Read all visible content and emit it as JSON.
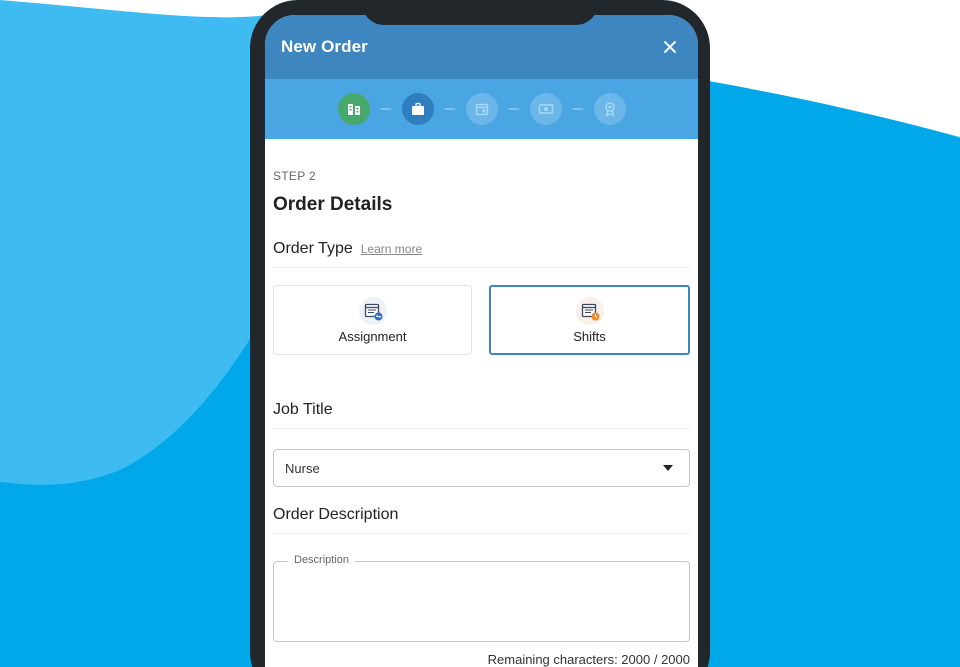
{
  "header": {
    "title": "New Order"
  },
  "stepper": {
    "steps": [
      {
        "icon": "building-icon",
        "state": "done"
      },
      {
        "icon": "briefcase-icon",
        "state": "active"
      },
      {
        "icon": "calendar-icon",
        "state": "pending"
      },
      {
        "icon": "money-icon",
        "state": "pending"
      },
      {
        "icon": "award-icon",
        "state": "pending"
      }
    ]
  },
  "form": {
    "step_label": "STEP 2",
    "title": "Order Details",
    "order_type": {
      "label": "Order Type",
      "learn_more": "Learn more",
      "options": [
        {
          "label": "Assignment",
          "icon": "calendar-assignment-icon",
          "selected": false
        },
        {
          "label": "Shifts",
          "icon": "calendar-shifts-icon",
          "selected": true
        }
      ]
    },
    "job_title": {
      "label": "Job Title",
      "value": "Nurse"
    },
    "order_description": {
      "label": "Order Description",
      "field_label": "Description",
      "remaining": "Remaining characters: 2000 / 2000"
    }
  },
  "colors": {
    "header": "#3e86bf",
    "stepper": "#4aa6e3",
    "step_done": "#46a86a",
    "step_active": "#2f7fc0",
    "accent": "#3e86bf"
  }
}
